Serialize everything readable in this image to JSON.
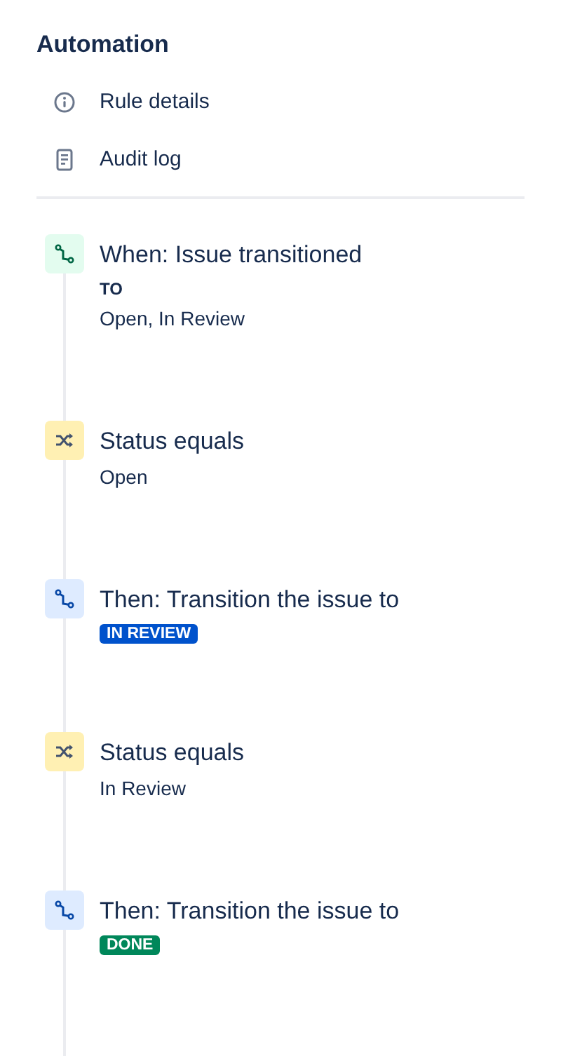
{
  "sidebar": {
    "title": "Automation",
    "items": [
      {
        "label": "Rule details",
        "kind": "info"
      },
      {
        "label": "Audit log",
        "kind": "document"
      }
    ]
  },
  "steps": [
    {
      "kind": "trigger",
      "title": "When: Issue transitioned",
      "details": [
        {
          "kind": "label",
          "text": "TO"
        },
        {
          "kind": "text",
          "text": "Open, In Review"
        }
      ]
    },
    {
      "kind": "condition",
      "title": "Status equals",
      "details": [
        {
          "kind": "text",
          "text": "Open"
        }
      ]
    },
    {
      "kind": "action",
      "title": "Then: Transition the issue to",
      "details": [
        {
          "kind": "lozenge",
          "text": "IN REVIEW",
          "color": "#0052cc"
        }
      ]
    },
    {
      "kind": "condition",
      "title": "Status equals",
      "details": [
        {
          "kind": "text",
          "text": "In Review"
        }
      ]
    },
    {
      "kind": "action",
      "title": "Then: Transition the issue to",
      "details": [
        {
          "kind": "lozenge",
          "text": "DONE",
          "color": "#00875a"
        }
      ]
    }
  ]
}
